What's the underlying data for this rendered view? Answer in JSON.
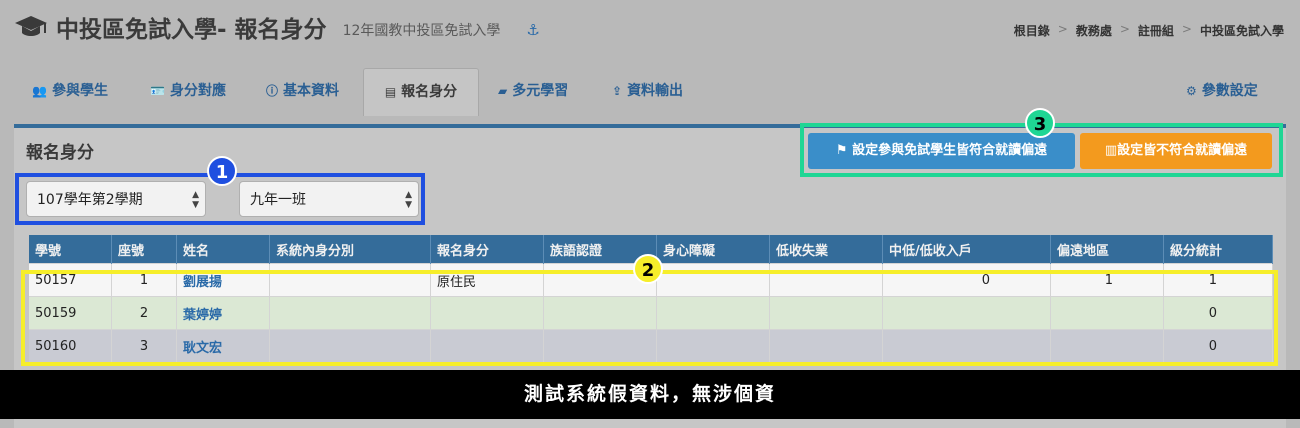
{
  "header": {
    "title": "中投區免試入學- 報名身分",
    "subtitle": "12年國教中投區免試入學",
    "anchor_icon": "anchor-icon"
  },
  "breadcrumb": [
    "根目錄",
    "教務處",
    "註冊組",
    "中投區免試入學"
  ],
  "tabs": [
    {
      "label": "參與學生",
      "icon": "user-plus-icon"
    },
    {
      "label": "身分對應",
      "icon": "id-card-icon"
    },
    {
      "label": "基本資料",
      "icon": "info-icon"
    },
    {
      "label": "報名身分",
      "icon": "id-card-icon",
      "active": true
    },
    {
      "label": "多元學習",
      "icon": "book-icon"
    },
    {
      "label": "資料輸出",
      "icon": "upload-icon"
    },
    {
      "label": "參數設定",
      "icon": "gear-icon"
    }
  ],
  "panel": {
    "title": "報名身分",
    "semester_select": "107學年第2學期",
    "class_select": "九年一班",
    "btn_all_match": "設定參與免試學生皆符合就讀偏遠",
    "btn_none_match": "設定皆不符合就讀偏遠"
  },
  "badges": [
    "1",
    "2",
    "3"
  ],
  "table": {
    "columns": [
      "學號",
      "座號",
      "姓名",
      "系統內身分別",
      "報名身分",
      "族語認證",
      "身心障礙",
      "低收失業",
      "中低/低收入戶",
      "偏遠地區",
      "級分統計"
    ],
    "rows": [
      [
        "50157",
        "1",
        "劉展揚",
        "",
        "原住民",
        "",
        "",
        "",
        "0",
        "1",
        "1"
      ],
      [
        "50159",
        "2",
        "葉婷婷",
        "",
        "",
        "",
        "",
        "",
        "",
        "",
        "0"
      ],
      [
        "50160",
        "3",
        "耿文宏",
        "",
        "",
        "",
        "",
        "",
        "",
        "",
        "0"
      ]
    ]
  },
  "caption": "測試系統假資料，無涉個資",
  "colors": {
    "header_blue": "#346c9a",
    "btn_blue": "#3a8ec9",
    "btn_orange": "#f39a1e",
    "box_blue": "#1f4fe0",
    "box_yellow": "#f6ee2a",
    "box_green": "#1fd694"
  }
}
